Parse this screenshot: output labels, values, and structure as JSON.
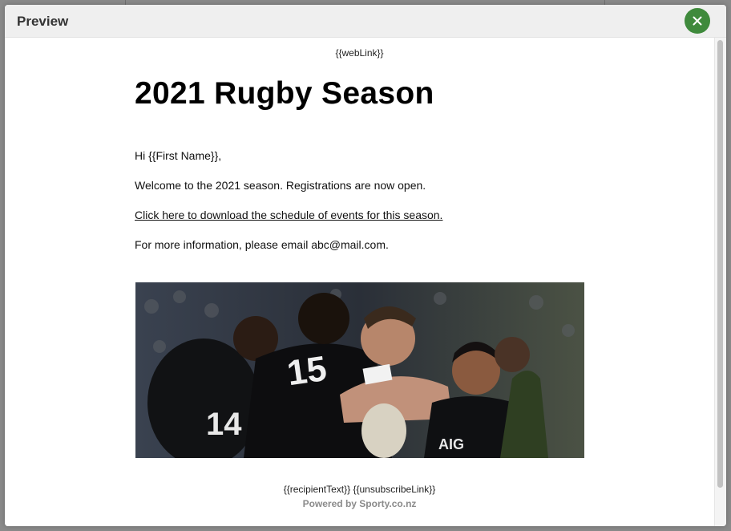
{
  "modal": {
    "title": "Preview",
    "close_icon": "close-icon",
    "accent_color": "#3f8a3c"
  },
  "email": {
    "web_link": "{{webLink}}",
    "heading": "2021 Rugby Season",
    "greeting": "Hi {{First Name}},",
    "welcome": "Welcome to the 2021 season. Registrations are now open.",
    "download_link": "Click here to download the schedule of events for this season. ",
    "info": "For more information, please email abc@mail.com.",
    "image_alt": "rugby players celebrating",
    "footer_vars": "{{recipientText}} {{unsubscribeLink}}",
    "powered_by": "Powered by Sporty.co.nz"
  }
}
